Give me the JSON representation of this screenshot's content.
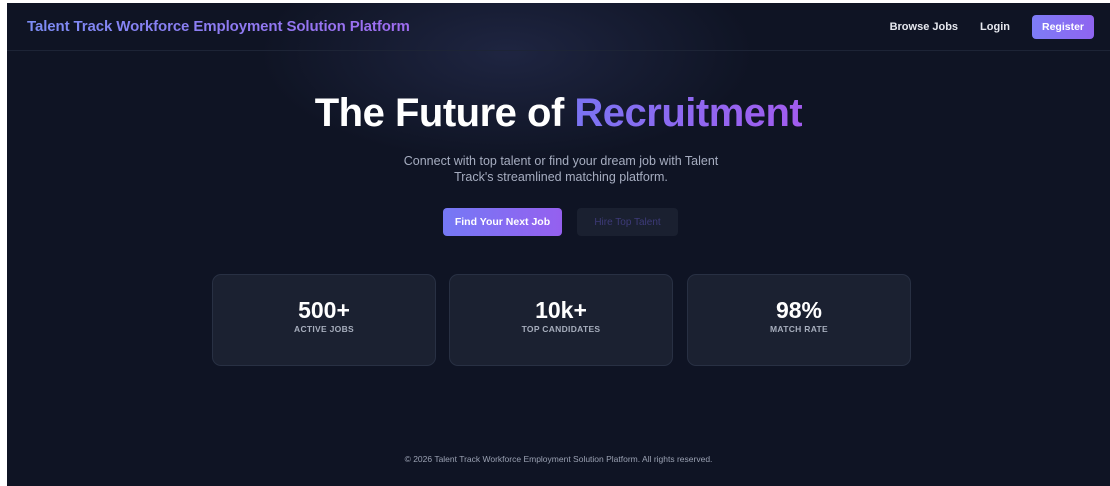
{
  "navbar": {
    "brand": "Talent Track Workforce Employment Solution Platform",
    "browse_jobs": "Browse Jobs",
    "login": "Login",
    "register": "Register"
  },
  "hero": {
    "title_main": "The Future of ",
    "title_accent": "Recruitment",
    "subtitle": "Connect with top talent or find your dream job with Talent Track's streamlined matching platform.",
    "primary_button": "Find Your Next Job",
    "secondary_button": "Hire Top Talent"
  },
  "stats": [
    {
      "value": "500+",
      "label": "ACTIVE JOBS"
    },
    {
      "value": "10k+",
      "label": "TOP CANDIDATES"
    },
    {
      "value": "98%",
      "label": "MATCH RATE"
    }
  ],
  "footer": {
    "text": "© 2026 Talent Track Workforce Employment Solution Platform. All rights reserved."
  },
  "colors": {
    "background": "#0f1424",
    "accent_start": "#7579f5",
    "accent_end": "#9560ef",
    "card": "#1b2131"
  }
}
